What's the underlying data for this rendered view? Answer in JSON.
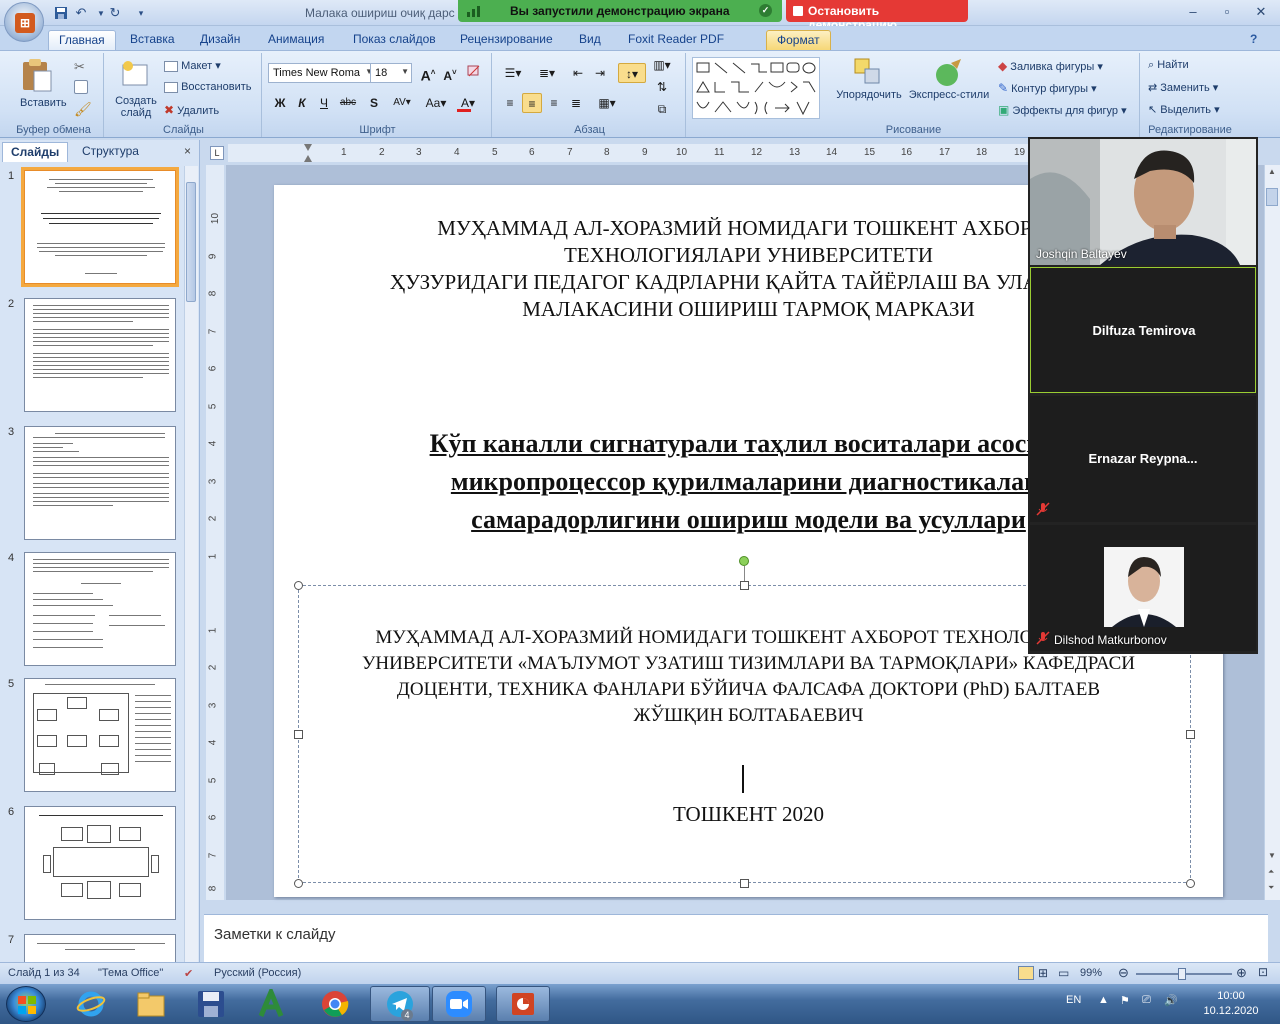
{
  "title_bar": {
    "document_title": "Малака ошириш очиқ дарс",
    "share_status": "Вы запустили демонстрацию экрана",
    "stop_share": "Остановить демонстрацию"
  },
  "ribbon": {
    "tabs": [
      "Главная",
      "Вставка",
      "Дизайн",
      "Анимация",
      "Показ слайдов",
      "Рецензирование",
      "Вид",
      "Foxit Reader PDF",
      "Формат"
    ],
    "clipboard": {
      "paste": "Вставить",
      "group": "Буфер обмена"
    },
    "slides": {
      "new_slide": "Создать слайд",
      "layout": "Макет",
      "reset": "Восстановить",
      "delete": "Удалить",
      "group": "Слайды"
    },
    "font": {
      "name": "Times New Roma",
      "size": "18",
      "group": "Шрифт"
    },
    "paragraph": {
      "group": "Абзац"
    },
    "drawing": {
      "arrange": "Упорядочить",
      "quick_styles": "Экспресс-стили",
      "fill": "Заливка фигуры",
      "outline": "Контур фигуры",
      "effects": "Эффекты для фигур",
      "group": "Рисование"
    },
    "editing": {
      "find": "Найти",
      "replace": "Заменить",
      "select": "Выделить",
      "group": "Редактирование"
    }
  },
  "left_panel": {
    "tabs": [
      "Слайды",
      "Структура"
    ],
    "close": "×",
    "slide_numbers": [
      "1",
      "2",
      "3",
      "4",
      "5",
      "6",
      "7"
    ]
  },
  "slide": {
    "org": [
      "МУҲАММАД АЛ-ХОРАЗМИЙ НОМИДАГИ ТОШКЕНТ АХБОРОТ",
      "ТЕХНОЛОГИЯЛАРИ УНИВЕРСИТЕТИ",
      "ҲУЗУРИДАГИ ПЕДАГОГ КАДРЛАРНИ ҚАЙТА ТАЙЁРЛАШ ВА УЛАРНИНГ",
      "МАЛАКАСИНИ ОШИРИШ ТАРМОҚ МАРКАЗИ"
    ],
    "title": [
      "Кўп каналли сигнатурали таҳлил воситалари асосида",
      "микропроцессор қурилмаларини диагностикалаш",
      "самарадорлигини ошириш модели ва усуллари"
    ],
    "author": [
      "МУҲАММАД АЛ-ХОРАЗМИЙ НОМИДАГИ ТОШКЕНТ АХБОРОТ ТЕХНОЛОГИЯЛАРИ",
      "УНИВЕРСИТЕТИ «МАЪЛУМОТ УЗАТИШ ТИЗИМЛАРИ ВА ТАРМОҚЛАРИ» КАФЕДРАСИ",
      "ДОЦЕНТИ, ТЕХНИКА ФАНЛАРИ БЎЙИЧА ФАЛСАФА ДОКТОРИ (PhD) БАЛТАЕВ",
      "ЖЎШҚИН БОЛТАБАЕВИЧ"
    ],
    "city": "ТОШКЕНТ 2020"
  },
  "ruler": {
    "h": [
      "1",
      "2",
      "3",
      "4",
      "5",
      "6",
      "7",
      "8",
      "9",
      "10",
      "11",
      "12",
      "13",
      "14",
      "15",
      "16",
      "17",
      "18",
      "19"
    ],
    "v": [
      "10",
      "9",
      "8",
      "7",
      "6",
      "5",
      "4",
      "3",
      "2",
      "1",
      "1",
      "2",
      "3",
      "4",
      "5",
      "6",
      "7",
      "8"
    ]
  },
  "notes": {
    "placeholder": "Заметки к слайду"
  },
  "status_bar": {
    "slide_info": "Слайд 1 из 34",
    "theme": "\"Тема Office\"",
    "language": "Русский (Россия)",
    "zoom": "99%"
  },
  "video_panel": {
    "participants": [
      {
        "name": "Joshqin Baltayev",
        "video": true,
        "muted": false
      },
      {
        "name": "Dilfuza Temirova",
        "video": false,
        "muted": false,
        "active": true
      },
      {
        "name": "Ernazar  Reypna...",
        "video": false,
        "muted": true
      },
      {
        "name": "Dilshod Matkurbonov",
        "video": true,
        "muted": true
      }
    ]
  },
  "taskbar": {
    "apps": [
      "internet-explorer",
      "file-explorer",
      "save-floppy",
      "acrobat-a",
      "chrome",
      "telegram",
      "zoom",
      "powerpoint"
    ],
    "telegram_badge": "4",
    "language": "EN",
    "time": "10:00",
    "date": "10.12.2020"
  }
}
